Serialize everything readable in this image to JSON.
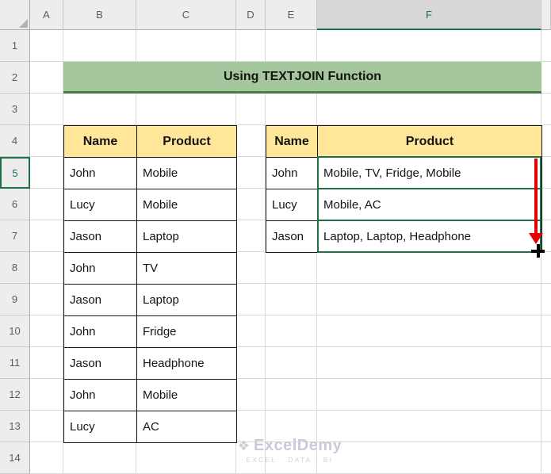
{
  "sheet": {
    "columns": [
      "A",
      "B",
      "C",
      "D",
      "E",
      "F"
    ],
    "rows": [
      "1",
      "2",
      "3",
      "4",
      "5",
      "6",
      "7",
      "8",
      "9",
      "10",
      "11",
      "12",
      "13",
      "14"
    ],
    "selected_column": "F",
    "selected_row": "5"
  },
  "title": {
    "text": "Using TEXTJOIN Function"
  },
  "left_table": {
    "headers": {
      "name": "Name",
      "product": "Product"
    },
    "rows": [
      {
        "name": "John",
        "product": "Mobile"
      },
      {
        "name": "Lucy",
        "product": "Mobile"
      },
      {
        "name": "Jason",
        "product": "Laptop"
      },
      {
        "name": "John",
        "product": "TV"
      },
      {
        "name": "Jason",
        "product": "Laptop"
      },
      {
        "name": "John",
        "product": "Fridge"
      },
      {
        "name": "Jason",
        "product": "Headphone"
      },
      {
        "name": "John",
        "product": "Mobile"
      },
      {
        "name": "Lucy",
        "product": "AC"
      }
    ]
  },
  "right_table": {
    "headers": {
      "name": "Name",
      "product": "Product"
    },
    "rows": [
      {
        "name": "John",
        "product": "Mobile, TV, Fridge, Mobile"
      },
      {
        "name": "Lucy",
        "product": "Mobile, AC"
      },
      {
        "name": "Jason",
        "product": "Laptop, Laptop, Headphone"
      }
    ]
  },
  "watermark": {
    "brand": "ExcelDemy",
    "tagline": "EXCEL · DATA · BI"
  },
  "colors": {
    "table_header_fill": "#FFE699",
    "banner_fill": "#A5C79D",
    "banner_border": "#4C7A45",
    "selection_green": "#1E7145",
    "arrow_red": "#E60000",
    "watermark_gray": "#C9CFDA"
  }
}
